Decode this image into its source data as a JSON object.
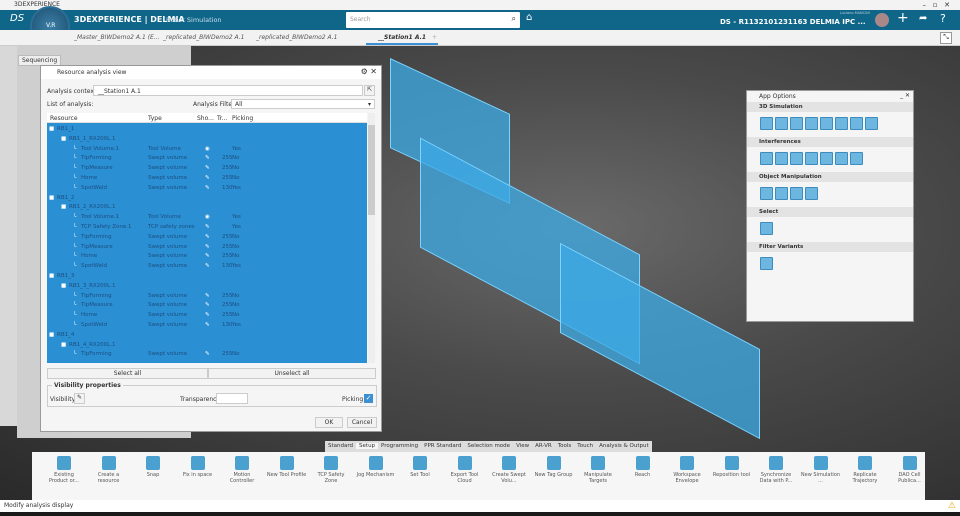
{
  "window_title": "3DEXPERIENCE",
  "header": {
    "brand": "3DEXPERIENCE | DELMIA",
    "app": "Robot Simulation",
    "search_placeholder": "Search",
    "user": "Luciano MANCINI",
    "tenant": "DS - R1132101231163 DELMIA IPC ...",
    "compass_version": "V.R"
  },
  "tabs": [
    "_Master_BIWDemo2 A.1 (E...",
    "_replicated_BIWDemo2 A.1",
    "_replicated_BIWDemo2 A.1",
    "__Station1 A.1"
  ],
  "active_tab": 3,
  "left_panel": {
    "tab": "Sequencing"
  },
  "dialog": {
    "title": "Resource analysis view",
    "context_label": "Analysis context:",
    "context_value": "__Station1 A.1",
    "list_label": "List of analysis:",
    "filter_label": "Analysis Filter:",
    "filter_value": "All",
    "columns": [
      "Resource",
      "Type",
      "Sho...",
      "Tr...",
      "Picking"
    ],
    "rows": [
      {
        "l": 0,
        "n": "RB1_1"
      },
      {
        "l": 1,
        "n": "RB1_1_RX200L.1"
      },
      {
        "l": 2,
        "n": "Tool Volume.1",
        "t": "Tool Volume",
        "s": "eye",
        "tr": "",
        "p": "Yes"
      },
      {
        "l": 2,
        "n": "TipForming",
        "t": "Swept volume",
        "s": "pen",
        "tr": "255",
        "p": "No"
      },
      {
        "l": 2,
        "n": "TipMeasure",
        "t": "Swept volume",
        "s": "pen",
        "tr": "255",
        "p": "No"
      },
      {
        "l": 2,
        "n": "Home",
        "t": "Swept volume",
        "s": "pen",
        "tr": "255",
        "p": "No"
      },
      {
        "l": 2,
        "n": "SpotWeld",
        "t": "Swept volume",
        "s": "pen",
        "tr": "130",
        "p": "Yes"
      },
      {
        "l": 0,
        "n": "RB1_2"
      },
      {
        "l": 1,
        "n": "RB1_2_RX200L.1"
      },
      {
        "l": 2,
        "n": "Tool Volume.1",
        "t": "Tool Volume",
        "s": "eye",
        "tr": "",
        "p": "Yes"
      },
      {
        "l": 2,
        "n": "TCP Safety Zone.1",
        "t": "TCP safety zones",
        "s": "pen",
        "tr": "",
        "p": "Yes"
      },
      {
        "l": 2,
        "n": "TipForming",
        "t": "Swept volume",
        "s": "pen",
        "tr": "255",
        "p": "No"
      },
      {
        "l": 2,
        "n": "TipMeasure",
        "t": "Swept volume",
        "s": "pen",
        "tr": "255",
        "p": "No"
      },
      {
        "l": 2,
        "n": "Home",
        "t": "Swept volume",
        "s": "pen",
        "tr": "255",
        "p": "No"
      },
      {
        "l": 2,
        "n": "SpotWeld",
        "t": "Swept volume",
        "s": "pen",
        "tr": "130",
        "p": "Yes"
      },
      {
        "l": 0,
        "n": "RB1_3"
      },
      {
        "l": 1,
        "n": "RB1_3_RX200L.1"
      },
      {
        "l": 2,
        "n": "TipForming",
        "t": "Swept volume",
        "s": "pen",
        "tr": "255",
        "p": "No"
      },
      {
        "l": 2,
        "n": "TipMeasure",
        "t": "Swept volume",
        "s": "pen",
        "tr": "255",
        "p": "No"
      },
      {
        "l": 2,
        "n": "Home",
        "t": "Swept volume",
        "s": "pen",
        "tr": "255",
        "p": "No"
      },
      {
        "l": 2,
        "n": "SpotWeld",
        "t": "Swept volume",
        "s": "pen",
        "tr": "130",
        "p": "Yes"
      },
      {
        "l": 0,
        "n": "RB1_4"
      },
      {
        "l": 1,
        "n": "RB1_4_RX200L.1"
      },
      {
        "l": 2,
        "n": "TipForming",
        "t": "Swept volume",
        "s": "pen",
        "tr": "255",
        "p": "No"
      }
    ],
    "select_all": "Select all",
    "unselect_all": "Unselect all",
    "visibility_group": "Visibility properties",
    "visibility_label": "Visibility:",
    "transparency_label": "Transparency:",
    "picking_label": "Picking",
    "picking_checked": true,
    "ok": "OK",
    "cancel": "Cancel"
  },
  "app_options": {
    "title": "App Options",
    "sections": [
      {
        "name": "3D Simulation",
        "icons": 8
      },
      {
        "name": "Interferences",
        "icons": 7
      },
      {
        "name": "Object Manipulation",
        "icons": 4
      },
      {
        "name": "Select",
        "icons": 1
      },
      {
        "name": "Filter Variants",
        "icons": 1
      }
    ]
  },
  "toolbar": {
    "tabs": [
      "Standard",
      "Setup",
      "Programming",
      "PPR Standard",
      "Selection mode",
      "View",
      "AR-VR",
      "Tools",
      "Touch",
      "Analysis & Output"
    ],
    "active_tab": 1,
    "items": [
      "Existing Product or...",
      "Create a resource",
      "Snap",
      "Fix in space",
      "Motion Controller",
      "New Tool Profile",
      "TCP Safety Zone",
      "Jog Mechanism",
      "Set Tool",
      "Export Tool Cloud",
      "Create Swept Volu...",
      "New Tag Group",
      "Manipulate Targets",
      "Reach",
      "Workspace Envelope",
      "Reposition tool",
      "Synchronize Data with P...",
      "New Simulation ...",
      "Replicate Trajectory",
      "DAO Cell Publica..."
    ]
  },
  "status": "Modify analysis display",
  "colors": {
    "header": "#0f6688",
    "selection": "#2b8fd4",
    "model": "#3caae6"
  }
}
